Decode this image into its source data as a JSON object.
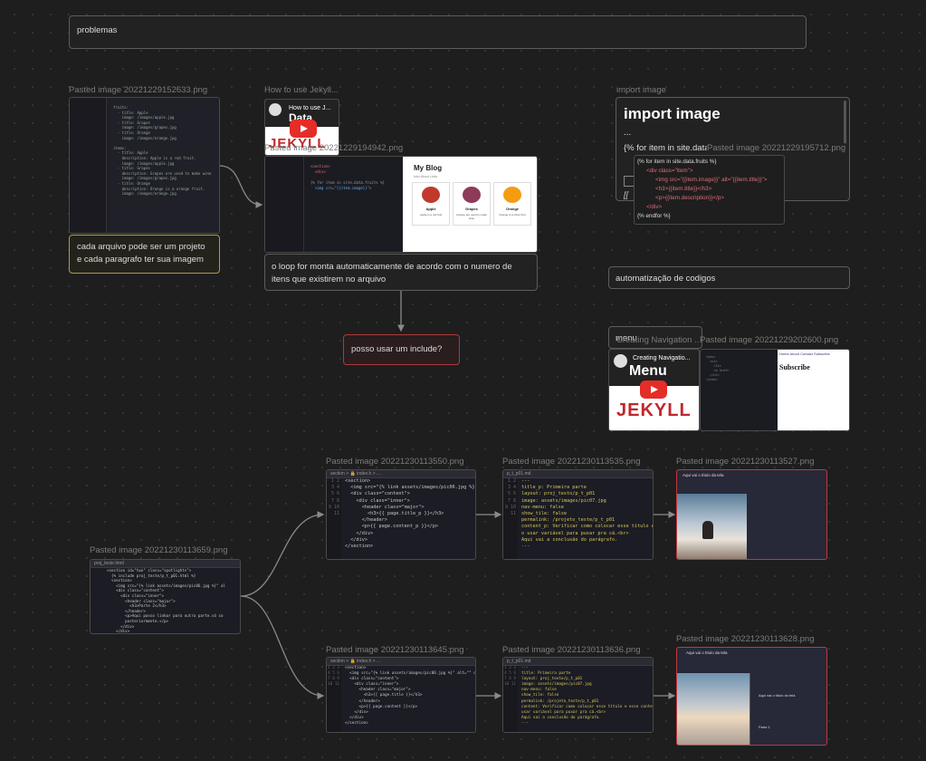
{
  "nodes": {
    "problemas": "problemas",
    "cada_arquivo": "cada arquivo pode ser um projeto e cada paragrafo ter sua imagem",
    "loop": "o loop for monta automaticamente de acordo com o numero de itens que existirem no arquivo",
    "include": "posso usar um include?",
    "automatizacao": "automatização de codigos",
    "menu": "menu"
  },
  "labels": {
    "img_152633": "Pasted image 20221229152633.png",
    "how_to_use": "How to use Jekyll...",
    "img_194942": "Pasted image 20221229194942.png",
    "import_image": "import image",
    "img_195712": "Pasted image 20221229195712.png",
    "creating_nav": "Creating Navigation ...",
    "img_202600": "Pasted image 20221229202600.png",
    "img_113550": "Pasted image 20221230113550.png",
    "img_113535": "Pasted image 20221230113535.png",
    "img_113527": "Pasted image 20221230113527.png",
    "img_113659": "Pasted image 20221230113659.png",
    "img_113645": "Pasted image 20221230113645.png",
    "img_113636": "Pasted image 20221230113636.png",
    "img_113628": "Pasted image 20221230113628.png"
  },
  "import_note": {
    "heading": "import image",
    "dots": "...",
    "for_line": "{% for item in site.data.fruits %}",
    "broken_link": "[[",
    "code": [
      "{% for item in site.data.fruits %}",
      "<div class=\"item\">",
      "<img src=\"{{item.image}}\" alt=\"{{item.title}}\">",
      "<h3>{{item.title}}</h3>",
      "<p>{{item.description}}</p>",
      "</div>",
      "{% endfor %}"
    ]
  },
  "videos": {
    "jekyll_title": "How to use J...",
    "jekyll_sub": "Data",
    "jekyll_word": "JEKYLL",
    "nav_title": "Creating Navigatio...",
    "nav_sub": "Menu",
    "nav_word": "JEKYLL"
  },
  "blog_preview": {
    "title": "My Blog",
    "subtitle": "Intro About Links",
    "items": [
      {
        "name": "Apple",
        "desc": "Apple is a red fruit"
      },
      {
        "name": "Grapes",
        "desc": "Grapes are used to make wine"
      },
      {
        "name": "Orange",
        "desc": "Orange is a citrus fruit"
      }
    ]
  },
  "subscribe_preview": {
    "nav": "Home  About  Contact  Subscribe",
    "heading": "Subscribe"
  },
  "code_113550": {
    "tab": "section > 🔒 index.h > ...",
    "lines": [
      "<section>",
      "  <img src=\"{% link assets/images/pic06.jpg %}",
      "  <div class=\"content\">",
      "    <div class=\"inner\">",
      "      <header class=\"major\">",
      "        <h3>{{ page.title_p }}</h3>",
      "      </header>",
      "      <p>{{ page.content_p }}</p>",
      "    </div>",
      "  </div>",
      "</section>"
    ]
  },
  "code_113535": {
    "tab": "p_t_p01.md",
    "lines": [
      "---",
      "title_p: Primeira parte",
      "layout: proj_texto/p_t_p01",
      "image: assets/images/pic07.jpg",
      "nav-menu: false",
      "show_tile: false",
      "permalink: /projeto_teste/p_t_p01",
      "content_p: Verificar como colocar esse título e",
      "o usar variável para puxar pra cá.<br>",
      "Aqui vai a conclusão do parágrafo.",
      "---"
    ]
  },
  "code_113659": {
    "tab": "proj_teste.html",
    "lines": [
      "<section id=\"two\" class=\"spotlights\">",
      "  {% include proj_teste/p_t_p01.html %}",
      "  <section>",
      "    <img src=\"{% link assets/images/pic06.jpg %}\" al",
      "    <div class=\"content\">",
      "      <div class=\"inner\">",
      "        <header class=\"major\">",
      "          <h3>Parte 2</h3>",
      "        </header>",
      "        <p>Aqui posso linkar para outra parte.só co",
      "        posteriormente.</p>",
      "      </div>",
      "    </div>"
    ]
  },
  "code_113645": {
    "tab": "section > 🔒 index.h > ...",
    "lines": [
      "<section>",
      "  <img src=\"{% link assets/images/pic06.jpg %}\" alt=\"\" data",
      "  <div class=\"content\">",
      "    <div class=\"inner\">",
      "      <header class=\"major\">",
      "        <h3>{{ page.title }}</h3>",
      "      </header>",
      "      <p>{{ page.content }}</p>",
      "    </div>",
      "  </div>",
      "</section>"
    ]
  },
  "code_113636": {
    "tab": "p_t_p01.md",
    "lines": [
      "---",
      "title: Primeira parte",
      "layout: proj_texto/p_t_p01",
      "image: assets/images/pic07.jpg",
      "nav-menu: false",
      "show_tile: false",
      "permalink: /projeto_teste/p_t_p01",
      "content: Verificar como colocar esse título e esse content em",
      "usar variável para puxar pra cá.<br>",
      "Aqui vai a conclusão do parágrafo.",
      "---"
    ]
  },
  "code_152633": {
    "lines": [
      "fruits:",
      "  - title: Apple",
      "    image: /images/apple.jpg",
      "  - title: Grapes",
      "    image: /images/grapes.jpg",
      "  - title: Orange",
      "    image: /images/orange.jpg",
      "",
      "items:",
      "  - title: Apple",
      "    description: Apple is a red fruit.",
      "    image: /images/apple.jpg",
      "  - title: Grapes",
      "    description: Grapes are used to make wine",
      "    image: /images/grapes.jpg",
      "  - title: Orange",
      "    description: Orange is a orange fruit.",
      "    image: /images/orange.jpg"
    ]
  },
  "site_preview": {
    "title_527": "Aqui vai o título da tela",
    "title_628": "Aqui vai o título da tela",
    "section_title": "Aqui vai o título do tela",
    "sidebar_title": "Parte 1"
  }
}
